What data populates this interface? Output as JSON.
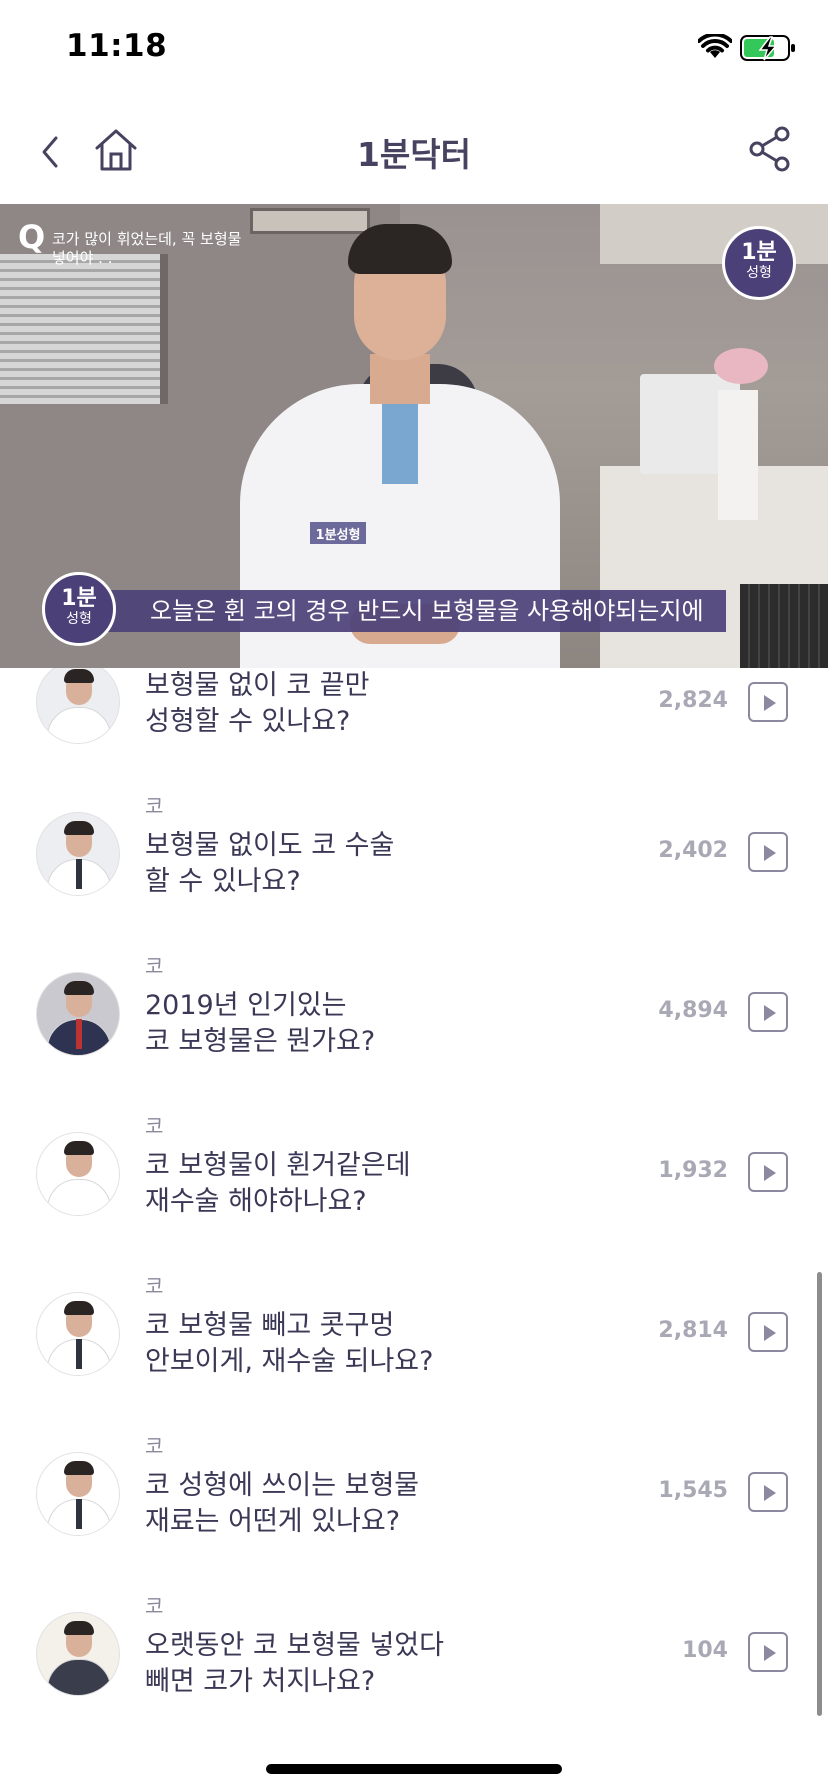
{
  "status_bar": {
    "time": "11:18"
  },
  "nav": {
    "title": "1분닥터"
  },
  "video": {
    "question_mark": "Q",
    "question_text": "코가 많이 휘었는데, 꼭 보형물 넣어야 . .",
    "logo_top_big": "1분",
    "logo_top_small": "성형",
    "logo_bottom_big": "1분",
    "logo_bottom_small": "성형",
    "badge_text": "1분성형",
    "subtitle": "오늘은 휜 코의 경우 반드시 보형물을 사용해야되는지에"
  },
  "list": {
    "items": [
      {
        "category": "",
        "title_line1": "보형물 없이 코 끝만",
        "title_line2": "성형할 수 있나요?",
        "views": "2,824"
      },
      {
        "category": "코",
        "title_line1": "보형물 없이도 코 수술",
        "title_line2": "할 수 있나요?",
        "views": "2,402"
      },
      {
        "category": "코",
        "title_line1": "2019년 인기있는",
        "title_line2": "코 보형물은 뭔가요?",
        "views": "4,894"
      },
      {
        "category": "코",
        "title_line1": "코 보형물이 휜거같은데",
        "title_line2": "재수술 해야하나요?",
        "views": "1,932"
      },
      {
        "category": "코",
        "title_line1": "코 보형물 빼고 콧구멍",
        "title_line2": "안보이게, 재수술 되나요?",
        "views": "2,814"
      },
      {
        "category": "코",
        "title_line1": "코 성형에 쓰이는 보형물",
        "title_line2": "재료는 어떤게 있나요?",
        "views": "1,545"
      },
      {
        "category": "코",
        "title_line1": "오랫동안 코 보형물 넣었다",
        "title_line2": "빼면 코가 처지나요?",
        "views": "104"
      }
    ]
  }
}
